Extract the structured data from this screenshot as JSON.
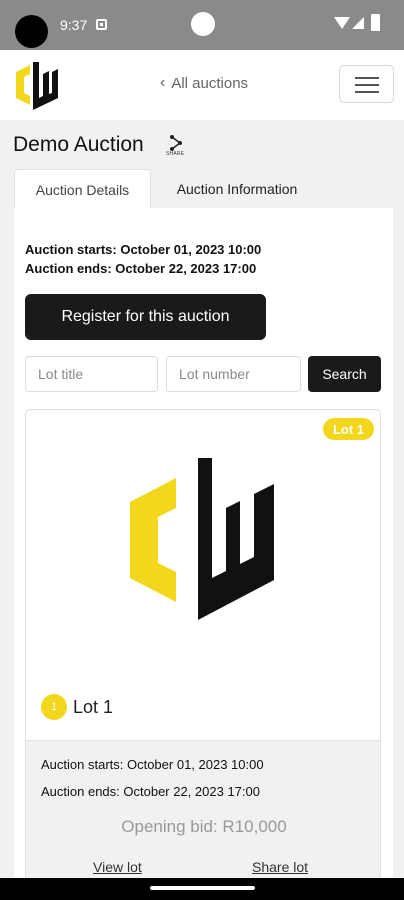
{
  "status_bar": {
    "time": "9:37"
  },
  "header": {
    "back_label": "All auctions",
    "back_icon": "chevron-left-icon",
    "menu_icon": "hamburger-icon"
  },
  "auction": {
    "title": "Demo Auction",
    "share_icon_label": "SHARE",
    "tabs": [
      {
        "label": "Auction Details",
        "active": true
      },
      {
        "label": "Auction Information",
        "active": false
      }
    ],
    "starts": "Auction starts: October 01, 2023 10:00",
    "ends": "Auction ends: October 22, 2023 17:00",
    "register_label": "Register for this auction"
  },
  "search": {
    "lot_title_placeholder": "Lot title",
    "lot_number_placeholder": "Lot number",
    "button_label": "Search"
  },
  "lot": {
    "badge": "Lot 1",
    "number": "1",
    "name": "Lot 1",
    "starts": "Auction starts: October 01, 2023 10:00",
    "ends": "Auction ends: October 22, 2023 17:00",
    "opening_bid": "Opening bid: R10,000",
    "view_label": "View lot",
    "share_label": "Share lot"
  },
  "colors": {
    "accent": "#f3d71c",
    "dark": "#1a1a1a",
    "background": "#f1f1f3"
  }
}
